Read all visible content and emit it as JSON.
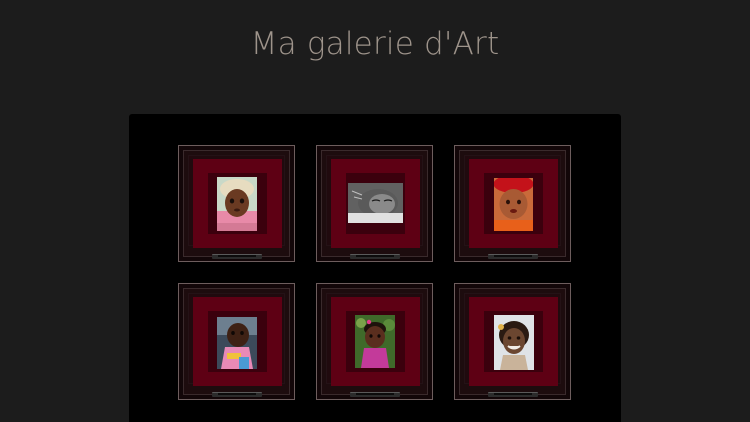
{
  "page": {
    "title": "Ma galerie d'Art"
  },
  "gallery": {
    "items": [
      {
        "subject": "portrait-child-headscarf",
        "bg": "#c1443d",
        "skin": "#6a3a22"
      },
      {
        "subject": "portrait-baby-sleeping-bw",
        "bg": "#a8a8a8",
        "skin": "#4a4a4a"
      },
      {
        "subject": "portrait-baby-red-hat",
        "bg": "#d4551e",
        "skin": "#8a4a2a"
      },
      {
        "subject": "portrait-child-pink-sweater",
        "bg": "#5a6a7a",
        "skin": "#4a2a1a"
      },
      {
        "subject": "portrait-girl-garden",
        "bg": "#4a6a2a",
        "skin": "#5a2e1e"
      },
      {
        "subject": "portrait-girl-smiling-sketch",
        "bg": "#cfd3d8",
        "skin": "#6b4630"
      }
    ]
  },
  "colors": {
    "page_bg": "#1c1c1c",
    "panel_bg": "#000000",
    "title": "#9e948b",
    "mat": "#5e0014",
    "frame": "#1d0c0e"
  }
}
